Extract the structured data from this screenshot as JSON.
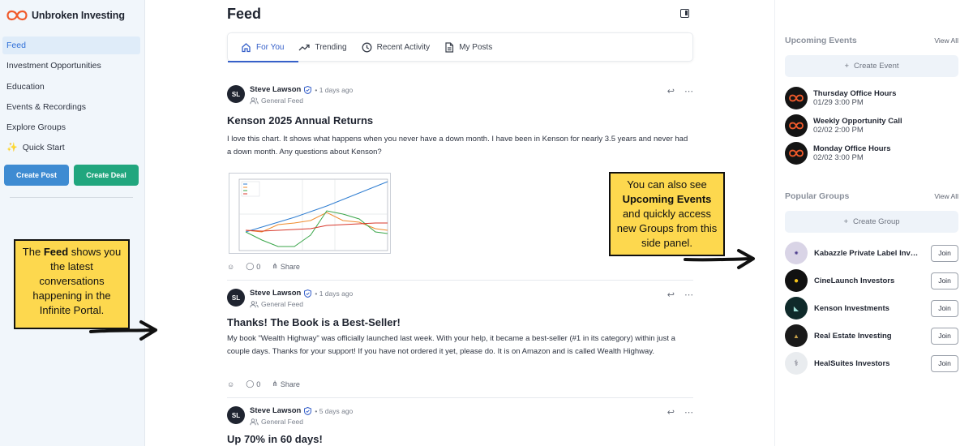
{
  "brand": {
    "name": "Unbroken Investing",
    "accent": "#f05a2b"
  },
  "sidebar": {
    "items": [
      {
        "label": "Feed",
        "active": true
      },
      {
        "label": "Investment Opportunities"
      },
      {
        "label": "Education"
      },
      {
        "label": "Events & Recordings"
      },
      {
        "label": "Explore Groups"
      },
      {
        "label": "Quick Start",
        "icon": "sparkle-icon"
      }
    ],
    "create_post": "Create Post",
    "create_deal": "Create Deal"
  },
  "feed": {
    "title": "Feed",
    "tabs": [
      {
        "label": "For You",
        "icon": "home-icon",
        "active": true
      },
      {
        "label": "Trending",
        "icon": "trending-icon"
      },
      {
        "label": "Recent Activity",
        "icon": "clock-icon"
      },
      {
        "label": "My Posts",
        "icon": "document-icon"
      }
    ],
    "posts": [
      {
        "initials": "SL",
        "author": "Steve Lawson",
        "time": "• 1 days ago",
        "group": "General Feed",
        "title": "Kenson 2025 Annual Returns",
        "body": "I love this chart. It shows what happens when you never have a down month. I have been in Kenson for nearly 3.5 years and never had a down month. Any questions about Kenson?",
        "comments": "0",
        "share": "Share"
      },
      {
        "initials": "SL",
        "author": "Steve Lawson",
        "time": "• 1 days ago",
        "group": "General Feed",
        "title": "Thanks! The Book is a Best-Seller!",
        "body": "My book \"Wealth Highway\" was officially launched last week. With your help, it became a best-seller (#1 in its category) within just a couple days. Thanks for your support! If you have not ordered it yet, please do. It is on Amazon and is called Wealth Highway.",
        "comments": "0",
        "share": "Share"
      },
      {
        "initials": "SL",
        "author": "Steve Lawson",
        "time": "• 5 days ago",
        "group": "General Feed",
        "title": "Up 70% in 60 days!"
      }
    ]
  },
  "events": {
    "title": "Upcoming Events",
    "view_all": "View All",
    "create": "Create Event",
    "items": [
      {
        "name": "Thursday Office Hours",
        "time": "01/29 3:00 PM"
      },
      {
        "name": "Weekly Opportunity Call",
        "time": "02/02 2:00 PM"
      },
      {
        "name": "Monday Office Hours",
        "time": "02/02 3:00 PM"
      }
    ]
  },
  "groups": {
    "title": "Popular Groups",
    "view_all": "View All",
    "create": "Create Group",
    "join": "Join",
    "items": [
      {
        "name": "Kabazzle Private Label Investors",
        "color": "#d9d4e6"
      },
      {
        "name": "CineLaunch Investors",
        "color": "#111111"
      },
      {
        "name": "Kenson Investments",
        "color": "#0f2a2a"
      },
      {
        "name": "Real Estate Investing",
        "color": "#1a1a1a"
      },
      {
        "name": "HealSuites Investors",
        "color": "#e9ecef"
      }
    ]
  },
  "callouts": {
    "feed": {
      "pre": "The ",
      "bold": "Feed",
      "post": " shows you the latest conversations happening in the Infinite Portal."
    },
    "side": {
      "pre": "You can also see ",
      "bold": "Upcoming Events",
      "post": " and quickly access new Groups from this side panel."
    }
  }
}
